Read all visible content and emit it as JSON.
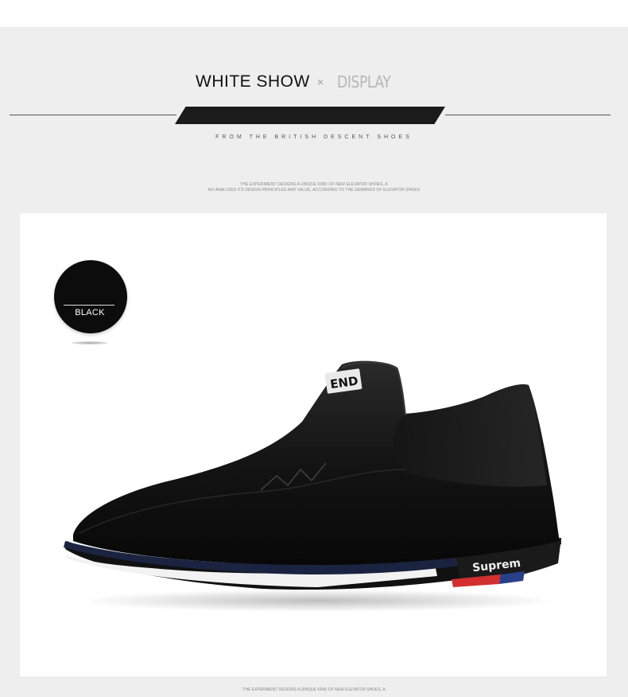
{
  "header": {
    "title": "WHITE SHOW",
    "separator": "×",
    "subtitle": "DISPLAY",
    "tagline": "FROM THE BRITISH DESCENT SHOES",
    "small_line_1": "THE EXPERIMENT DESIGNS A UNIQUE KIND OF NEW ELEVATOR SHOES, A",
    "small_line_2": "NO ANALYZES ITS DESIGN PRINCIPLES AND VALUE, ACCORDING TO THE DEMANDS OF ELEVATOR SHOES"
  },
  "swatch": {
    "label": "BLACK",
    "color": "#0c0c0c"
  },
  "product": {
    "tongue_logo": "END",
    "sole_brand": "Suprem",
    "icon": "slip-on-shoe-image"
  },
  "footer": {
    "text": "THE EXPERIMENT DESIGNS A UNIQUE KIND OF NEW ELEVATOR SHOES, A"
  },
  "colors": {
    "background": "#eeeeee",
    "panel": "#ffffff",
    "bar": "#1b1b1b",
    "sole_red": "#d23030",
    "sole_blue": "#2a3f8a"
  }
}
